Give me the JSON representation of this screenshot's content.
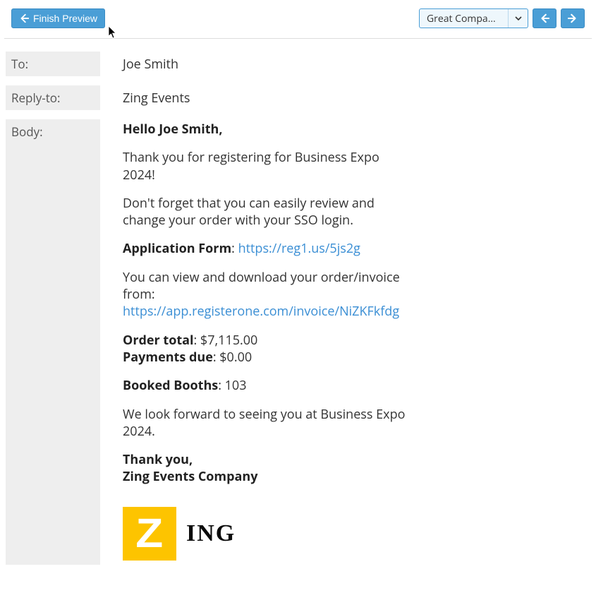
{
  "toolbar": {
    "finish_label": "Finish Preview",
    "dropdown_selected": "Great Compan…"
  },
  "fields": {
    "to_label": "To:",
    "to_value": "Joe Smith",
    "reply_label": "Reply-to:",
    "reply_value": "Zing Events",
    "body_label": "Body:"
  },
  "body": {
    "greeting": "Hello Joe Smith,",
    "thanks_register": "Thank you for registering for Business Expo 2024!",
    "sso_note": "Don't forget that you can easily review and change your order with your SSO login.",
    "app_form_label": "Application Form",
    "app_form_sep": ": ",
    "app_form_link": "https://reg1.us/5js2g",
    "invoice_intro": "You can view and download your order/invoice from: ",
    "invoice_link": "https://app.registerone.com/invoice/NiZKFkfdg",
    "order_total_label": "Order total",
    "order_total_value": ": $7,115.00",
    "payments_due_label": "Payments due",
    "payments_due_value": ": $0.00",
    "booked_label": "Booked Booths",
    "booked_value": ": 103",
    "closing_line": "We look forward to seeing you at Business Expo 2024.",
    "signoff1": "Thank you,",
    "signoff2": "Zing Events Company",
    "logo_text": "ING"
  }
}
